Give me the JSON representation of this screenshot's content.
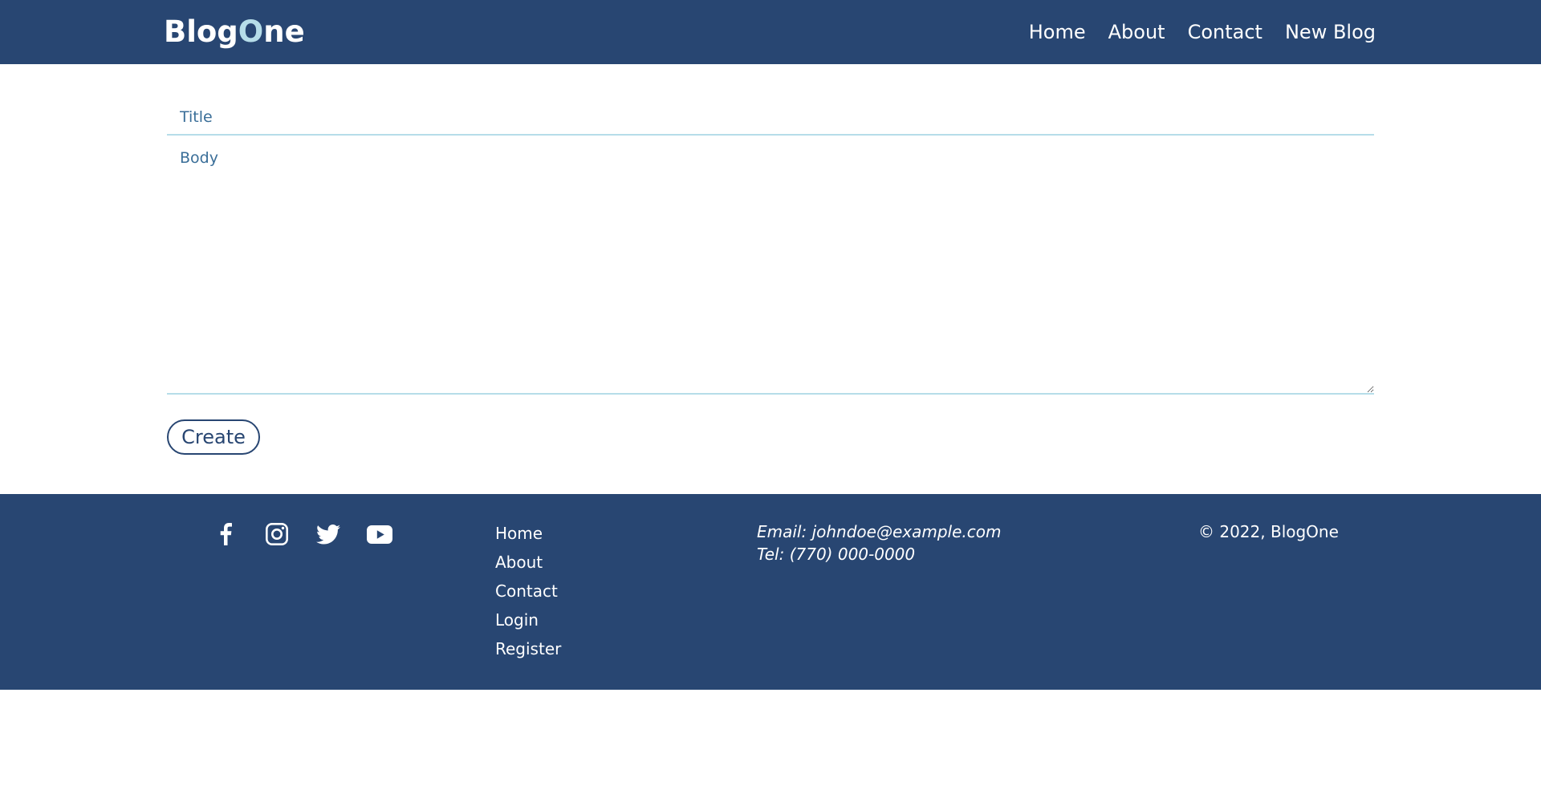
{
  "header": {
    "brand_part1": "Blog",
    "brand_accent": "O",
    "brand_part2": "ne",
    "nav": [
      "Home",
      "About",
      "Contact",
      "New Blog"
    ]
  },
  "form": {
    "title_placeholder": "Title",
    "title_value": "",
    "body_placeholder": "Body",
    "body_value": "",
    "submit_label": "Create"
  },
  "footer": {
    "social_icons": [
      "facebook-icon",
      "instagram-icon",
      "twitter-icon",
      "youtube-icon"
    ],
    "links": [
      "Home",
      "About",
      "Contact",
      "Login",
      "Register"
    ],
    "email": "Email: johndoe@example.com",
    "tel": "Tel: (770) 000-0000",
    "copyright": "© 2022, BlogOne"
  },
  "colors": {
    "primary": "#284672",
    "accent": "#b6dde9",
    "placeholder_text": "#3a6e98",
    "background": "#ffffff"
  }
}
